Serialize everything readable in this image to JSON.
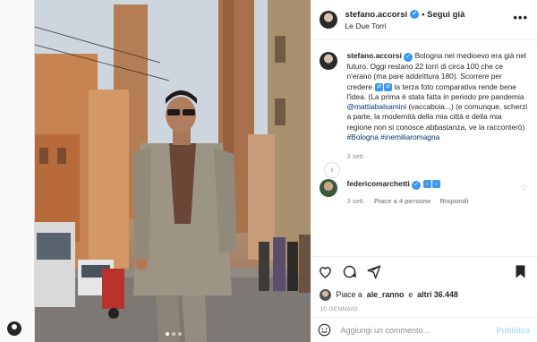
{
  "post": {
    "username": "stefano.accorsi",
    "follow_label": "• Segui già",
    "location": "Le Due Torri",
    "more_label": "•••",
    "caption_prefix": "Bologna nel medioevo era già nel futuro. Oggi restano 22 torri di circa 100 che ce n'erano (ma pare addirittura 180). Scorrere per credere",
    "caption_mid": "la terza foto comparativa rende bene l'idea. (La prima è stata fatta in periodo pre pandemia",
    "mention": "@mattiabalsamini",
    "caption_rest": "(vaccaboia...) (e comunque, scherzi a parte, la modernità della mia città e della mia regione non si conosce abbastanza, ve la racconterò)",
    "hashtags": "#Bologna #inemiliaromagna",
    "time_ago": "3 sett."
  },
  "reply": {
    "username": "federicomarchetti",
    "time_ago": "3 sett.",
    "likes": "Piace a 4 persone",
    "reply_label": "Rispondi"
  },
  "likes": {
    "prefix": "Piace a",
    "user": "ale_ranno",
    "middle": "e",
    "others": "altri 36.448"
  },
  "date": "10 GENNAIO",
  "comment": {
    "placeholder": "Aggiungi un commento...",
    "publish_label": "Pubblica"
  },
  "carousel": {
    "next_label": "›",
    "total_slides": 3,
    "active_slide": 1
  },
  "colors": {
    "verified": "#3897f0",
    "link": "#00376b",
    "publish": "#b2dffc"
  },
  "icons": [
    "heart-icon",
    "comment-icon",
    "share-icon",
    "bookmark-icon",
    "emoji-icon",
    "verified-icon",
    "more-icon"
  ]
}
